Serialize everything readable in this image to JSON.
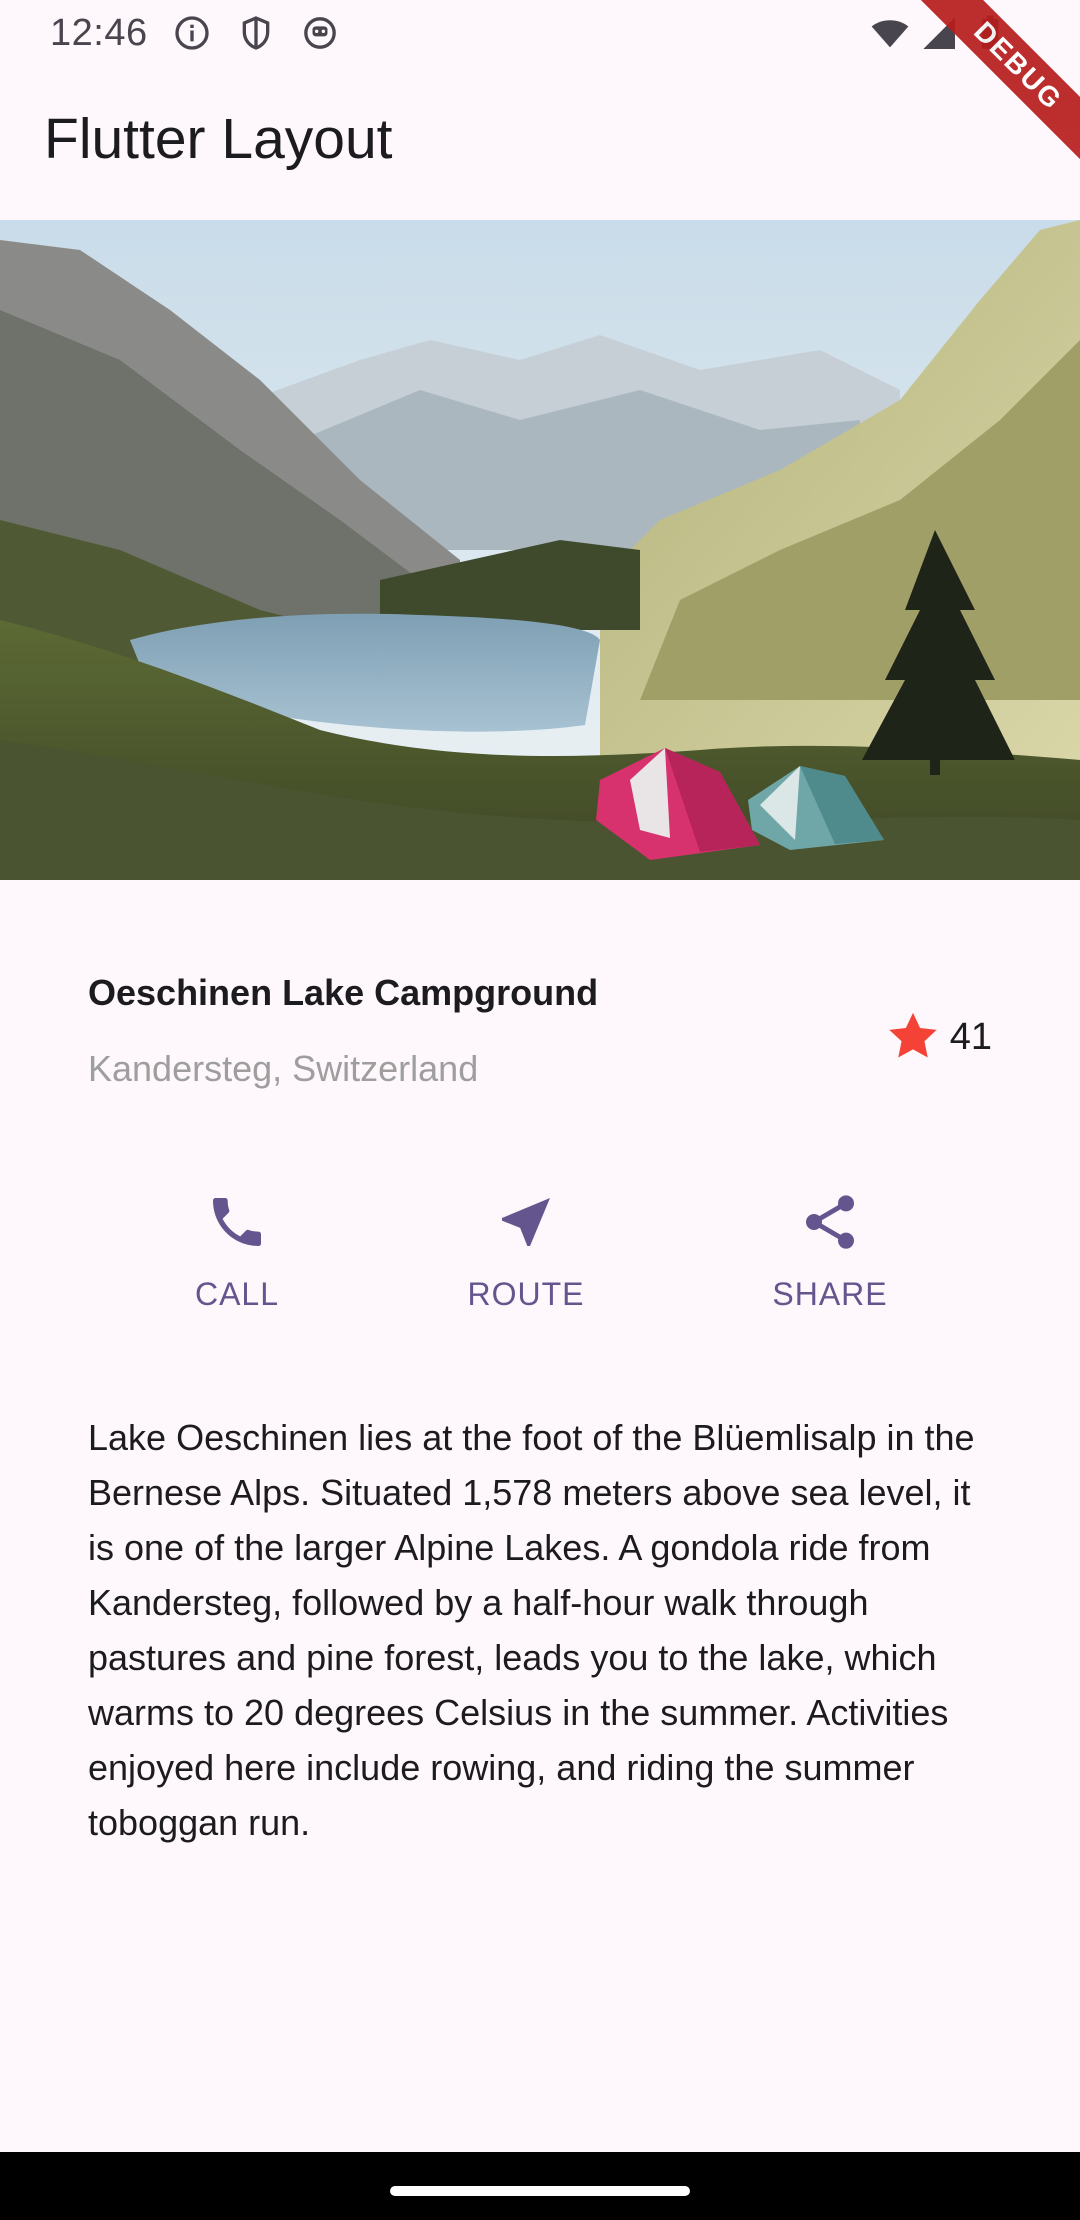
{
  "status_bar": {
    "time": "12:46",
    "left_icons": [
      "info-icon",
      "shield-icon",
      "robot-icon"
    ],
    "right_icons": [
      "wifi-icon",
      "signal-icon",
      "battery-icon"
    ]
  },
  "debug_banner": "DEBUG",
  "app_bar": {
    "title": "Flutter Layout"
  },
  "hero": {
    "image": "lake-campground-photo"
  },
  "place": {
    "name": "Oeschinen Lake Campground",
    "location": "Kandersteg, Switzerland",
    "rating_count": "41",
    "star_color": "#f44336"
  },
  "actions": [
    {
      "label": "CALL",
      "icon": "phone-icon"
    },
    {
      "label": "ROUTE",
      "icon": "navigation-icon"
    },
    {
      "label": "SHARE",
      "icon": "share-icon"
    }
  ],
  "accent_color": "#65558f",
  "description": "Lake Oeschinen lies at the foot of the Blüemlisalp in the Bernese Alps. Situated 1,578 meters above sea level, it is one of the larger Alpine Lakes. A gondola ride from Kandersteg, followed by a half-hour walk through pastures and pine forest, leads you to the lake, which warms to 20 degrees Celsius in the summer. Activities enjoyed here include rowing, and riding the summer toboggan run."
}
